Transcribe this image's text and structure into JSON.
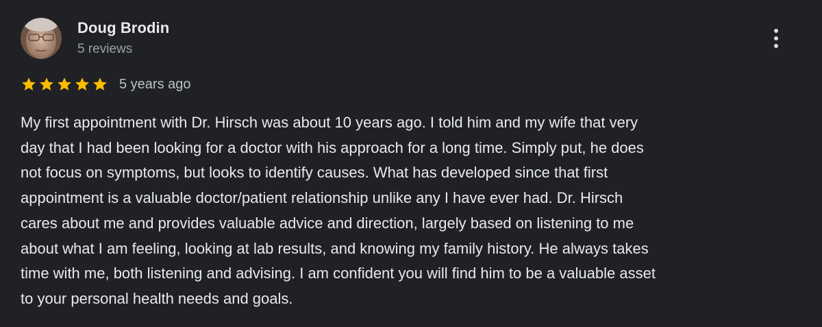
{
  "review": {
    "author": {
      "name": "Doug Brodin",
      "reviews_count": "5 reviews",
      "avatar_icon": "user-photo"
    },
    "rating": {
      "stars": 5,
      "max_stars": 5,
      "star_color": "#fbbc04",
      "date": "5 years ago"
    },
    "more_icon": "more-vert-icon",
    "text_lines": [
      "My first appointment with Dr. Hirsch was about 10 years ago. I told him and my wife that very",
      "day that I had been looking for a doctor with his approach for a long time. Simply put, he does",
      "not focus on symptoms, but looks to identify causes. What has developed since that first",
      "appointment is a valuable doctor/patient relationship unlike any I have ever had. Dr. Hirsch",
      "cares about me and provides valuable advice and direction, largely based on listening to me",
      "about what I am feeling, looking at lab results, and knowing my family history. He always takes",
      "time with me, both listening and advising. I am confident you will find him to be a valuable asset",
      "to your personal health needs and goals."
    ]
  },
  "colors": {
    "background": "#202124",
    "primary_text": "#e8eaed",
    "secondary_text": "#9aa0a6"
  }
}
